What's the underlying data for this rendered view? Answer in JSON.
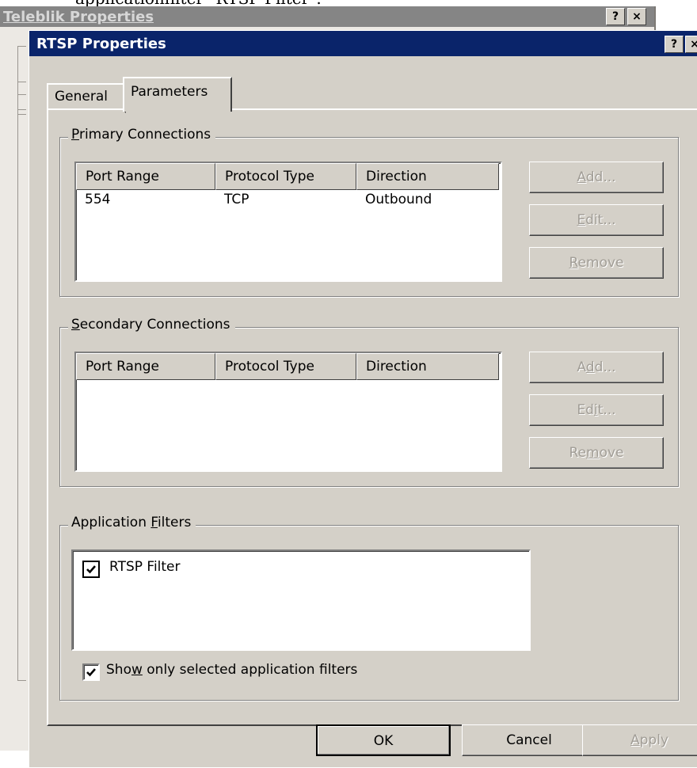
{
  "caption": "applicationfilter \"RTSP Filter\".",
  "background_window": {
    "title": "Teleblik Properties",
    "help_glyph": "?",
    "close_glyph": "×"
  },
  "dialog": {
    "title": "RTSP Properties",
    "help_glyph": "?",
    "close_glyph": "×",
    "tabs": [
      "General",
      "Parameters"
    ],
    "active_tab": "Parameters",
    "primary": {
      "legend_accel": "P",
      "legend_rest": "rimary Connections",
      "columns": [
        "Port Range",
        "Protocol Type",
        "Direction"
      ],
      "rows": [
        {
          "port": "554",
          "protocol": "TCP",
          "direction": "Outbound"
        }
      ],
      "buttons": {
        "add": {
          "pre": "",
          "accel": "A",
          "post": "dd..."
        },
        "edit": {
          "pre": "",
          "accel": "E",
          "post": "dit..."
        },
        "remove": {
          "pre": "",
          "accel": "R",
          "post": "emove"
        }
      }
    },
    "secondary": {
      "legend_accel": "S",
      "legend_rest": "econdary Connections",
      "columns": [
        "Port Range",
        "Protocol Type",
        "Direction"
      ],
      "buttons": {
        "add": {
          "pre": "A",
          "accel": "d",
          "post": "d..."
        },
        "edit": {
          "pre": "Ed",
          "accel": "i",
          "post": "t..."
        },
        "remove": {
          "pre": "Re",
          "accel": "m",
          "post": "ove"
        }
      }
    },
    "filters": {
      "legend_pre": "Application ",
      "legend_accel": "F",
      "legend_post": "ilters",
      "items": [
        {
          "label": "RTSP Filter",
          "checked": true
        }
      ],
      "show_only": {
        "pre": "Sho",
        "accel": "w",
        "post": " only selected application filters",
        "checked": true
      }
    },
    "footer": {
      "ok": "OK",
      "cancel": "Cancel",
      "apply_accel": "A",
      "apply_rest": "pply"
    }
  }
}
